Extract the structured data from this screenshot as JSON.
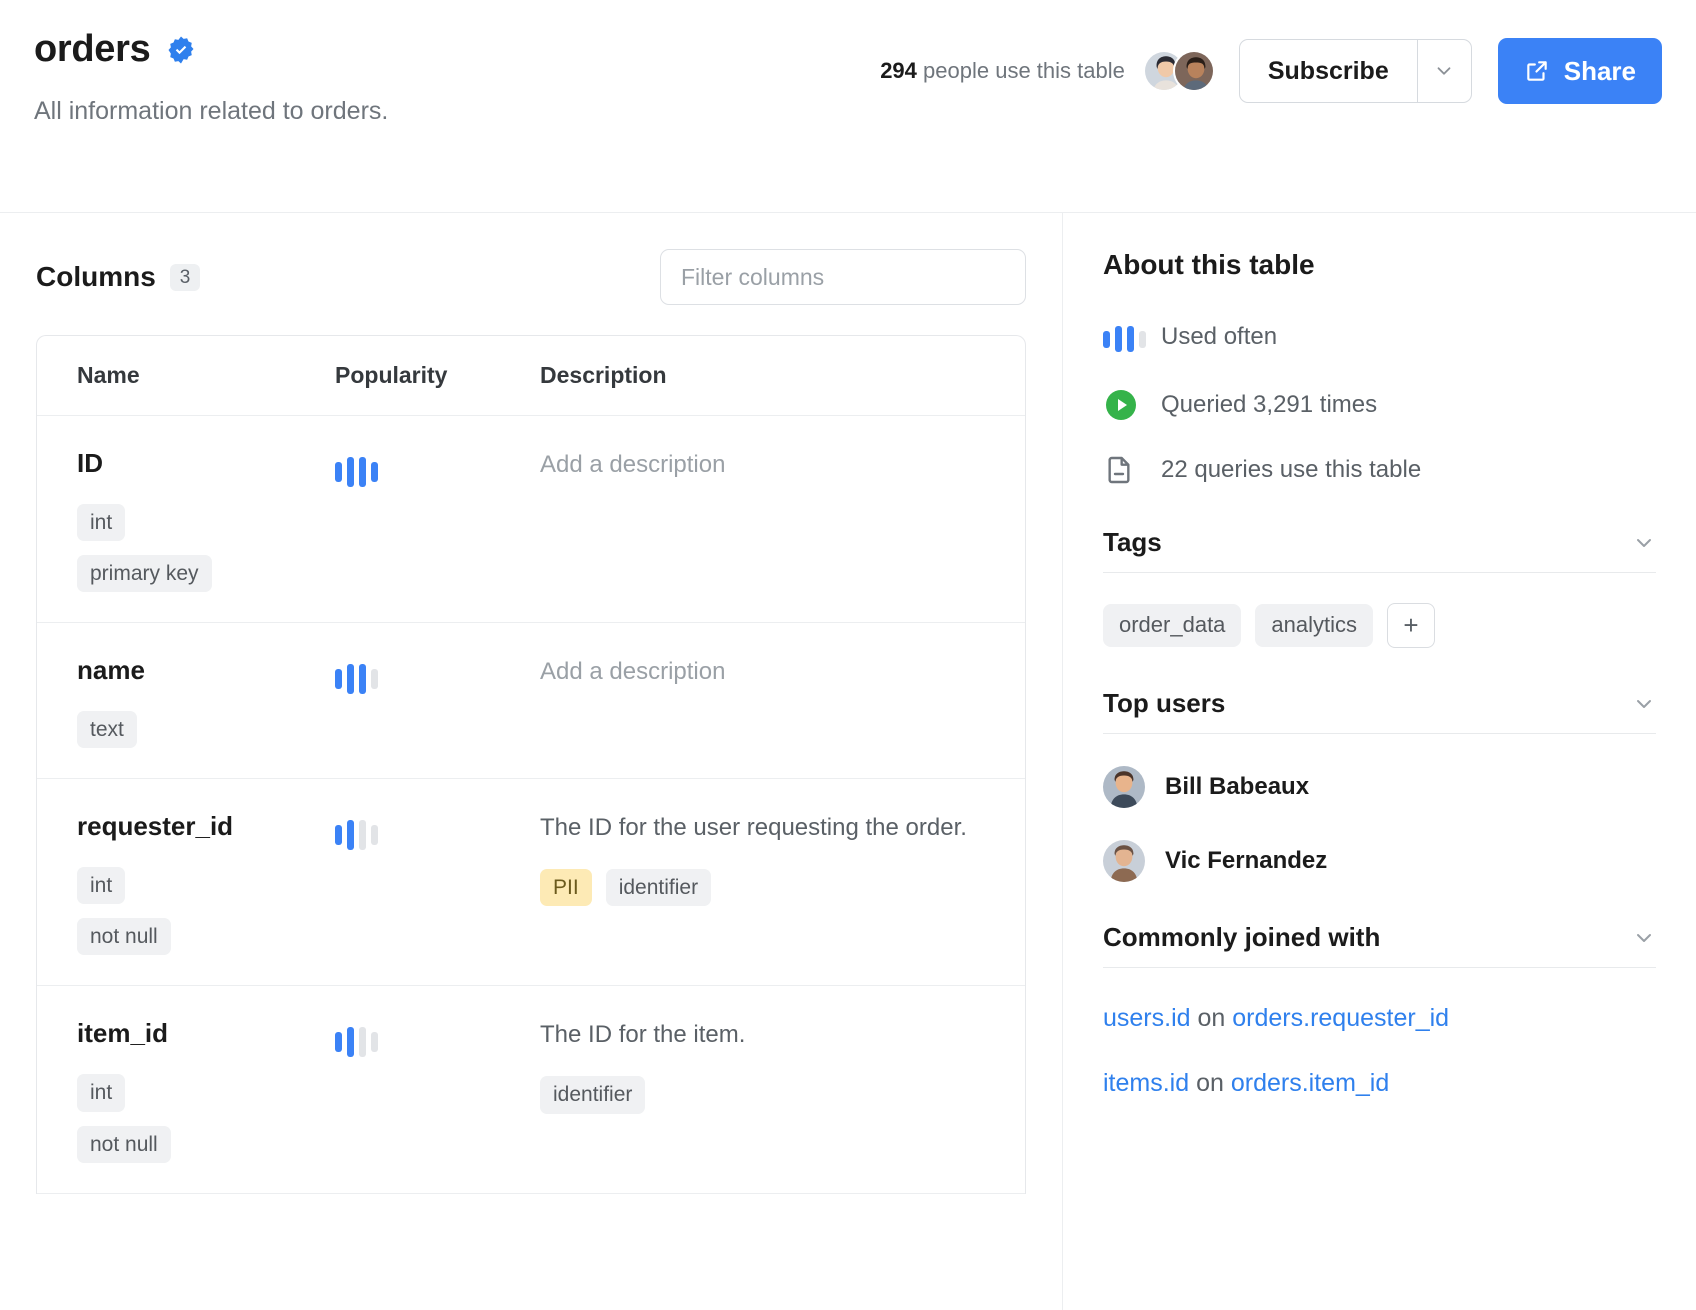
{
  "header": {
    "title": "orders",
    "verified_icon": "verified-badge-icon",
    "subtitle": "All information related to orders.",
    "usage_count": "294",
    "usage_suffix": "people use this table",
    "subscribe_label": "Subscribe",
    "subscribe_caret_icon": "chevron-down-icon",
    "share_label": "Share",
    "share_icon": "external-link-icon",
    "accent_color": "#3b82f6"
  },
  "columns_panel": {
    "heading": "Columns",
    "count": "3",
    "filter_placeholder": "Filter columns",
    "table_headers": {
      "name": "Name",
      "popularity": "Popularity",
      "description": "Description"
    },
    "rows": [
      {
        "name": "ID",
        "popularity_filled": 4,
        "popularity_total": 4,
        "description": "Add a description",
        "description_is_placeholder": true,
        "type_chips": [
          "int",
          "primary key"
        ],
        "desc_chips": []
      },
      {
        "name": "name",
        "popularity_filled": 3,
        "popularity_total": 4,
        "description": "Add a description",
        "description_is_placeholder": true,
        "type_chips": [
          "text"
        ],
        "desc_chips": []
      },
      {
        "name": "requester_id",
        "popularity_filled": 2,
        "popularity_total": 4,
        "description": "The ID for the user requesting the order.",
        "description_is_placeholder": false,
        "type_chips": [
          "int",
          "not null"
        ],
        "desc_chips": [
          {
            "label": "PII",
            "style": "pii"
          },
          {
            "label": "identifier",
            "style": "default"
          }
        ]
      },
      {
        "name": "item_id",
        "popularity_filled": 2,
        "popularity_total": 4,
        "description": "The ID for the item.",
        "description_is_placeholder": false,
        "type_chips": [
          "int",
          "not null"
        ],
        "desc_chips": [
          {
            "label": "identifier",
            "style": "default"
          }
        ]
      }
    ]
  },
  "sidebar": {
    "title": "About this table",
    "facts": [
      {
        "icon": "popularity-bars-icon",
        "text": "Used often",
        "filled": 3,
        "total": 4
      },
      {
        "icon": "play-circle-icon",
        "text": "Queried 3,291 times"
      },
      {
        "icon": "document-icon",
        "text": "22 queries use this table"
      }
    ],
    "tags_section": {
      "title": "Tags",
      "collapse_icon": "chevron-down-icon",
      "tags": [
        "order_data",
        "analytics"
      ],
      "add_label": "+"
    },
    "top_users_section": {
      "title": "Top users",
      "collapse_icon": "chevron-down-icon",
      "users": [
        "Bill Babeaux",
        "Vic Fernandez"
      ]
    },
    "joins_section": {
      "title": "Commonly joined with",
      "collapse_icon": "chevron-down-icon",
      "joins": [
        {
          "left": "users.id",
          "conj": "on",
          "right": "orders.requester_id"
        },
        {
          "left": "items.id",
          "conj": "on",
          "right": "orders.item_id"
        }
      ]
    }
  }
}
